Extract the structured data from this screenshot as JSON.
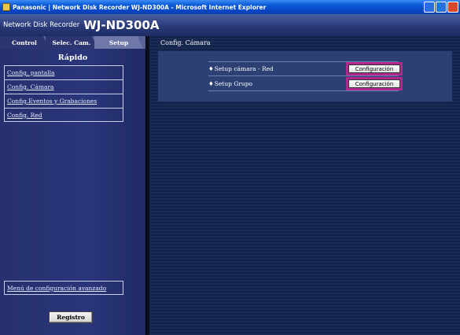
{
  "window": {
    "title": "Panasonic | Network Disk Recorder WJ-ND300A - Microsoft Internet Explorer"
  },
  "header": {
    "brand_sub": "Network Disk Recorder",
    "brand_model": "WJ-ND300A"
  },
  "tabs": [
    {
      "label": "Control"
    },
    {
      "label": "Selec. Cam."
    },
    {
      "label": "Setup",
      "active": true
    }
  ],
  "sidebar": {
    "title": "Rápido",
    "items": [
      {
        "label": "Config. pantalla"
      },
      {
        "label": "Config. Cámara"
      },
      {
        "label": "Config.Eventos y Grabaciones"
      },
      {
        "label": "Config. Red"
      }
    ],
    "advanced_link": "Menú de configuración avanzado",
    "register_button": "Registro"
  },
  "main": {
    "section_title": "Config. Cámara",
    "rows": [
      {
        "bullet": "♦",
        "label": "Setup cámara - Red",
        "button": "Configuración"
      },
      {
        "bullet": "♦",
        "label": "Setup Grupo",
        "button": "Configuración"
      }
    ]
  },
  "colors": {
    "highlight": "#b0288c",
    "panel": "#2c4074",
    "sidebar": "#2a367a"
  }
}
